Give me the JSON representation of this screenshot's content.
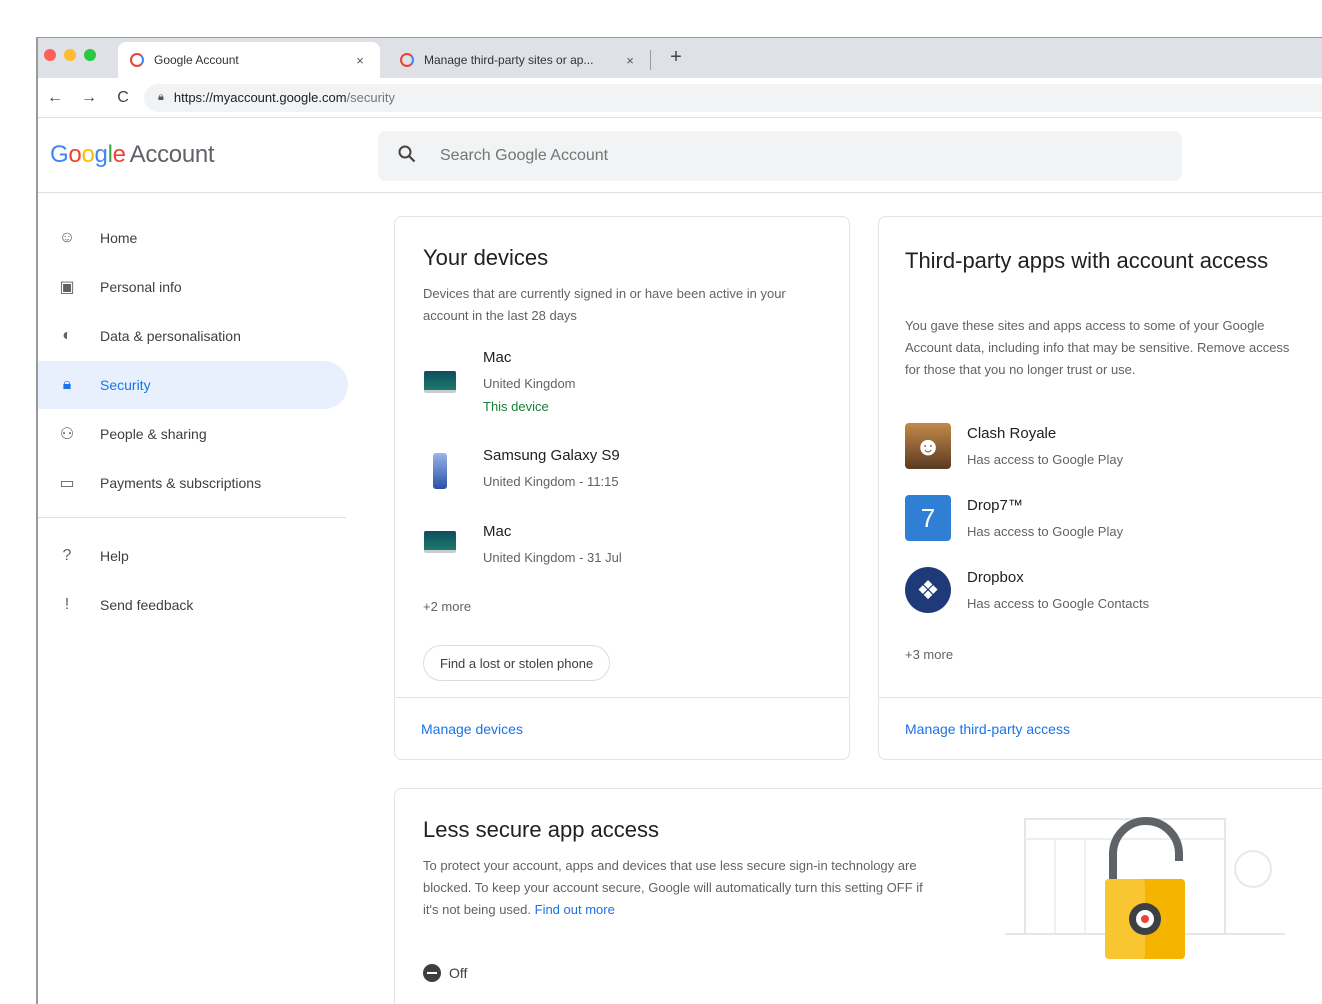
{
  "browser": {
    "traffic_lights": [
      "#ff5f57",
      "#febc2e",
      "#28c840"
    ],
    "tabs": [
      {
        "title": "Google Account",
        "close": "×"
      },
      {
        "title": "Manage third-party sites or ap...",
        "close": "×"
      }
    ],
    "new_tab": "+",
    "nav": {
      "back": "←",
      "forward": "→",
      "reload": "C"
    },
    "url_host": "https://myaccount.google.com",
    "url_path": "/security"
  },
  "header": {
    "logo_letters": [
      {
        "ch": "G",
        "color": "#4285f4"
      },
      {
        "ch": "o",
        "color": "#ea4335"
      },
      {
        "ch": "o",
        "color": "#fbbc05"
      },
      {
        "ch": "g",
        "color": "#4285f4"
      },
      {
        "ch": "l",
        "color": "#34a853"
      },
      {
        "ch": "e",
        "color": "#ea4335"
      }
    ],
    "logo_suffix": "Account",
    "search_placeholder": "Search Google Account"
  },
  "sidebar": {
    "items": [
      {
        "label": "Home",
        "icon": "home-icon",
        "glyph": "☺"
      },
      {
        "label": "Personal info",
        "icon": "id-card-icon",
        "glyph": "▣"
      },
      {
        "label": "Data & personalisation",
        "icon": "toggle-icon",
        "glyph": "◐"
      },
      {
        "label": "Security",
        "icon": "lock-icon",
        "glyph": "🔒︎"
      },
      {
        "label": "People & sharing",
        "icon": "people-icon",
        "glyph": "⚇"
      },
      {
        "label": "Payments & subscriptions",
        "icon": "card-icon",
        "glyph": "▭"
      }
    ],
    "secondary": [
      {
        "label": "Help",
        "icon": "help-icon",
        "glyph": "?"
      },
      {
        "label": "Send feedback",
        "icon": "feedback-icon",
        "glyph": "!"
      }
    ],
    "active_index": 3
  },
  "devices_card": {
    "title": "Your devices",
    "description": "Devices that are currently signed in or have been active in your account in the last 28 days",
    "devices": [
      {
        "name": "Mac",
        "location": "United Kingdom",
        "note": "This device",
        "kind": "laptop"
      },
      {
        "name": "Samsung Galaxy S9",
        "location": "United Kingdom - 11:15",
        "note": "",
        "kind": "phone"
      },
      {
        "name": "Mac",
        "location": "United Kingdom - 31 Jul",
        "note": "",
        "kind": "laptop"
      }
    ],
    "more": "+2 more",
    "find_phone": "Find a lost or stolen phone",
    "manage": "Manage devices"
  },
  "apps_card": {
    "title": "Third-party apps with account access",
    "description": "You gave these sites and apps access to some of your Google Account data, including info that may be sensitive. Remove access for those that you no longer trust or use.",
    "apps": [
      {
        "name": "Clash Royale",
        "access": "Has access to Google Play",
        "icon": "clash-royale-icon",
        "color": "#6b4a2e",
        "glyph": "☻"
      },
      {
        "name": "Drop7™",
        "access": "Has access to Google Play",
        "icon": "drop7-icon",
        "color": "#2f7fd4",
        "glyph": "7"
      },
      {
        "name": "Dropbox",
        "access": "Has access to Google Contacts",
        "icon": "dropbox-icon",
        "color": "#1e3a78",
        "glyph": "❖"
      }
    ],
    "more": "+3 more",
    "manage": "Manage third-party access"
  },
  "less_secure_card": {
    "title": "Less secure app access",
    "description": "To protect your account, apps and devices that use less secure sign-in technology are blocked. To keep your account secure, Google will automatically turn this setting OFF if it's not being used.",
    "link": "Find out more",
    "toggle_state": "Off"
  }
}
